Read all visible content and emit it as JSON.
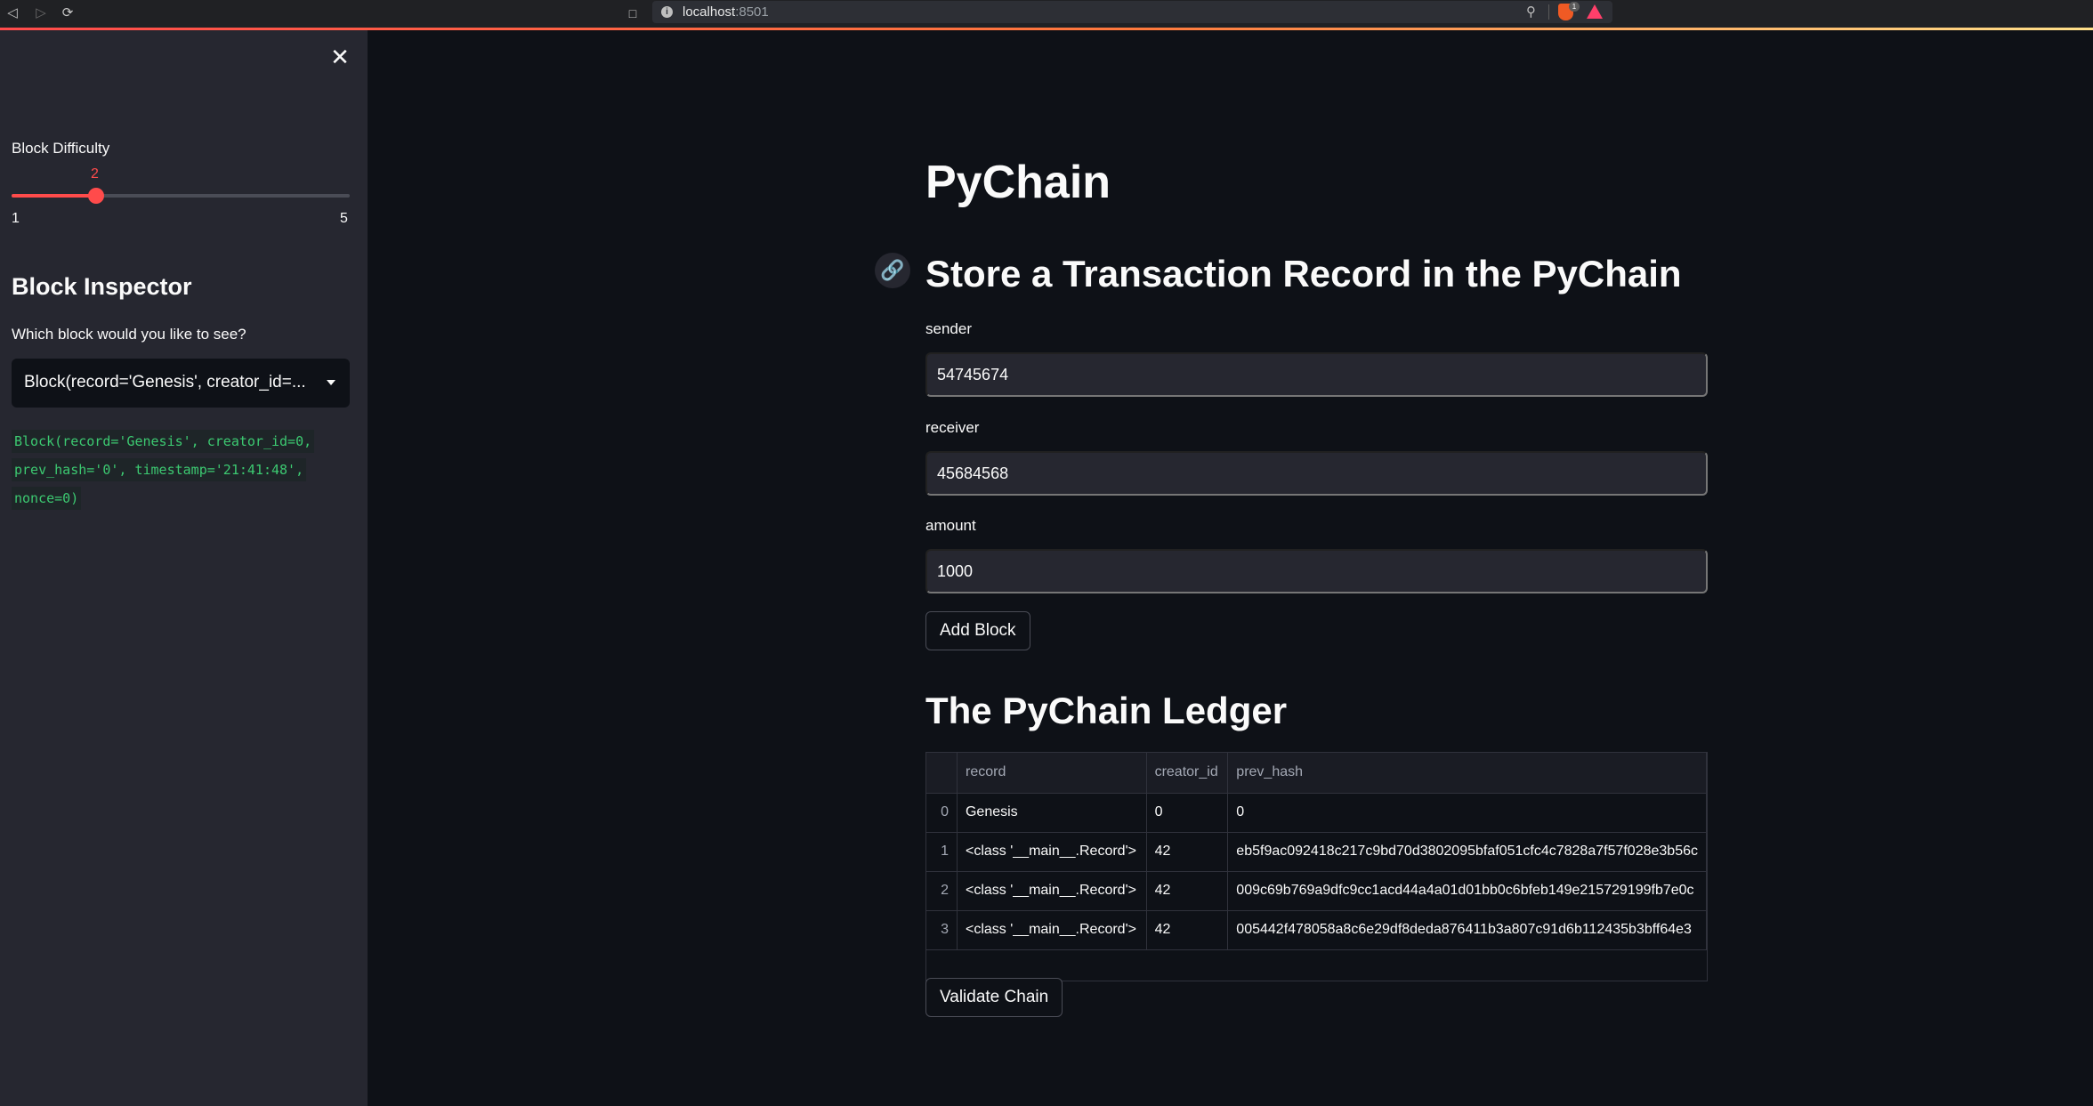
{
  "browser": {
    "url_host": "localhost",
    "url_port": ":8501",
    "extension_badge": "1"
  },
  "sidebar": {
    "slider": {
      "label": "Block Difficulty",
      "value": 2,
      "min": 1,
      "max": 5,
      "value_label": "2",
      "min_label": "1",
      "max_label": "5",
      "accent_color": "#ff4b4b"
    },
    "inspector_title": "Block Inspector",
    "select_label": "Which block would you like to see?",
    "select_value": "Block(record='Genesis', creator_id=...",
    "code_output": "Block(record='Genesis', creator_id=0, prev_hash='0', timestamp='21:41:48', nonce=0)"
  },
  "main": {
    "title": "PyChain",
    "subtitle": "Store a Transaction Record in the PyChain",
    "fields": {
      "sender_label": "sender",
      "sender_value": "54745674",
      "receiver_label": "receiver",
      "receiver_value": "45684568",
      "amount_label": "amount",
      "amount_value": "1000"
    },
    "add_block_label": "Add Block",
    "ledger_title": "The PyChain Ledger",
    "validate_label": "Validate Chain"
  },
  "ledger": {
    "columns": [
      "record",
      "creator_id",
      "prev_hash"
    ],
    "rows": [
      {
        "index": "0",
        "record": "Genesis",
        "creator_id": "0",
        "prev_hash": "0"
      },
      {
        "index": "1",
        "record": "<class '__main__.Record'>",
        "creator_id": "42",
        "prev_hash": "eb5f9ac092418c217c9bd70d3802095bfaf051cfc4c7828a7f57f028e3b56c"
      },
      {
        "index": "2",
        "record": "<class '__main__.Record'>",
        "creator_id": "42",
        "prev_hash": "009c69b769a9dfc9cc1acd44a4a01d01bb0c6bfeb149e215729199fb7e0c"
      },
      {
        "index": "3",
        "record": "<class '__main__.Record'>",
        "creator_id": "42",
        "prev_hash": "005442f478058a8c6e29df8deda876411b3a807c91d6b112435b3bff64e3"
      }
    ]
  }
}
